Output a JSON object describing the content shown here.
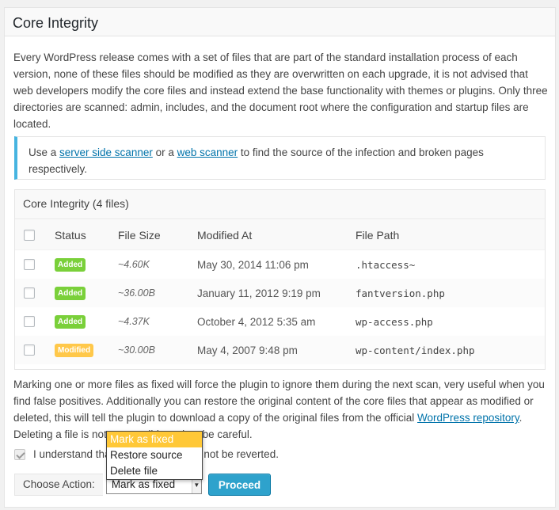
{
  "panel": {
    "title": "Core Integrity",
    "intro": "Every WordPress release comes with a set of files that are part of the standard installation process of each version, none of these files should be modified as they are overwritten on each upgrade, it is not advised that web developers modify the core files and instead extend the base functionality with themes or plugins. Only three directories are scanned: admin, includes, and the document root where the configuration and startup files are located."
  },
  "notice": {
    "text_before": "Use a ",
    "link1": "server side scanner",
    "text_middle": " or a ",
    "link2": "web scanner",
    "text_after": " to find the source of the infection and broken pages respectively."
  },
  "table": {
    "caption": "Core Integrity (4 files)",
    "headers": {
      "status": "Status",
      "size": "File Size",
      "modified": "Modified At",
      "path": "File Path"
    },
    "rows": [
      {
        "status": "Added",
        "size": "~4.60K",
        "modified": "May 30, 2014 11:06 pm",
        "path": ".htaccess~"
      },
      {
        "status": "Added",
        "size": "~36.00B",
        "modified": "January 11, 2012 9:19 pm",
        "path": "fantversion.php"
      },
      {
        "status": "Added",
        "size": "~4.37K",
        "modified": "October 4, 2012 5:35 am",
        "path": "wp-access.php"
      },
      {
        "status": "Modified",
        "size": "~30.00B",
        "modified": "May 4, 2007 9:48 pm",
        "path": "wp-content/index.php"
      }
    ]
  },
  "outro": {
    "text": "Marking one or more files as fixed will force the plugin to ignore them during the next scan, very useful when you find false positives. Additionally you can restore the original content of the core files that appear as modified or deleted, this will tell the plugin to download a copy of the original files from the official ",
    "link": "WordPress repository",
    "text_after": ". Deleting a file is not a reversible action, be careful."
  },
  "understand": {
    "label": "I understand that this operation can not be reverted."
  },
  "actions": {
    "label": "Choose Action:",
    "selected": "Mark as fixed",
    "options": [
      "Mark as fixed",
      "Restore source",
      "Delete file"
    ],
    "proceed": "Proceed"
  },
  "colors": {
    "accent": "#46b4e0",
    "added": "#7ad03a",
    "modified": "#ffc84a",
    "button": "#2ea2cc"
  },
  "icons": {
    "dropdown_arrow": "chevron-down-icon",
    "checked": "check-icon"
  }
}
